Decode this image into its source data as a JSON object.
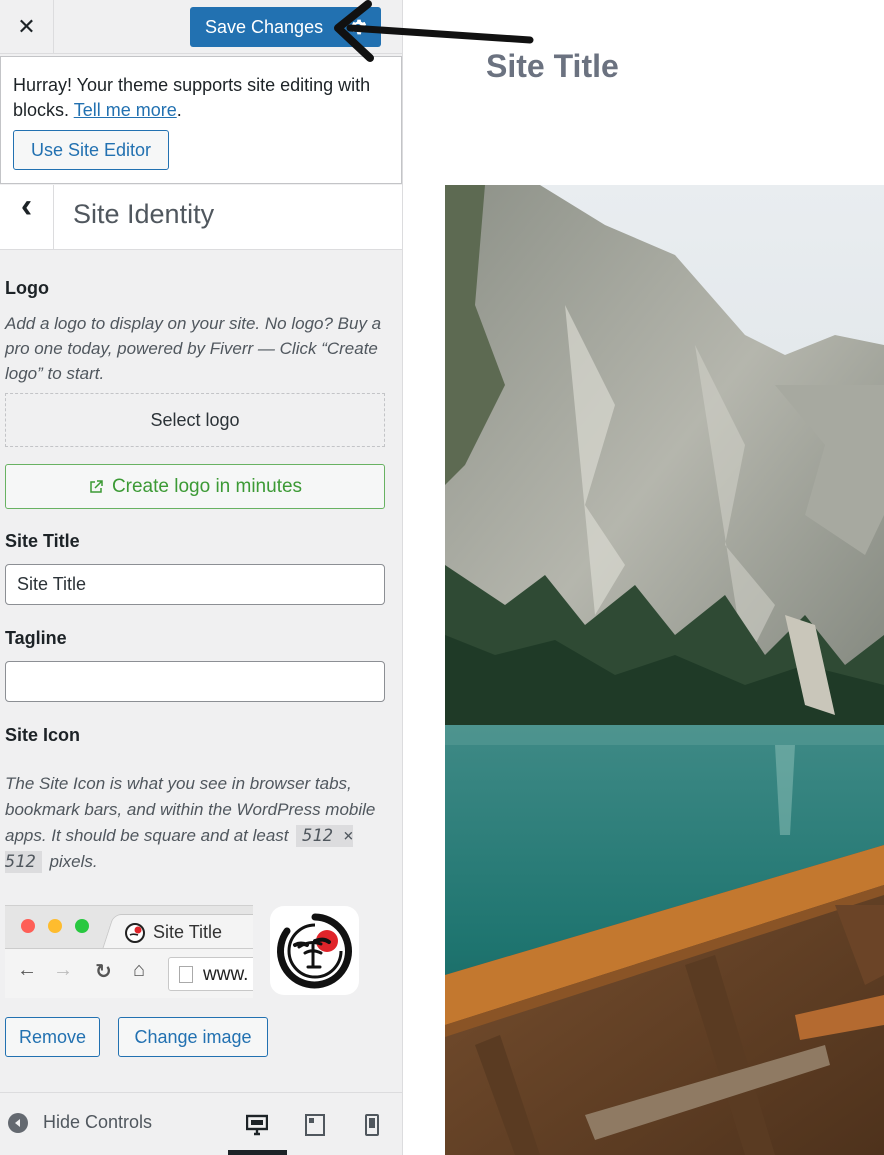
{
  "topbar": {
    "close_glyph": "✕",
    "save_label": "Save Changes"
  },
  "notice": {
    "text_before": "Hurray! Your theme supports site editing with blocks. ",
    "link_text": "Tell me more",
    "text_after": ".",
    "button_label": "Use Site Editor"
  },
  "section": {
    "back_glyph": "‹",
    "title": "Site Identity"
  },
  "logo": {
    "label": "Logo",
    "description": "Add a logo to display on your site. No logo? Buy a pro one today, powered by Fiverr — Click “Create logo” to start.",
    "select_label": "Select logo",
    "create_label": "Create logo in minutes"
  },
  "site_title": {
    "label": "Site Title",
    "value": "Site Title"
  },
  "tagline": {
    "label": "Tagline",
    "value": ""
  },
  "site_icon": {
    "label": "Site Icon",
    "desc_before": "The Site Icon is what you see in browser tabs, bookmark bars, and within the WordPress mobile apps. It should be square and at least ",
    "dimension": "512 × 512",
    "desc_after": " pixels.",
    "browser_tab_title": "Site Title",
    "browser_url": "www.",
    "remove_label": "Remove",
    "change_label": "Change image"
  },
  "footer": {
    "hide_controls_label": "Hide Controls",
    "devices": [
      "desktop",
      "tablet",
      "mobile"
    ],
    "active_device": "desktop"
  },
  "preview": {
    "site_title": "Site Title"
  },
  "colors": {
    "primary": "#2271b1",
    "create_logo_green": "#3c9a35",
    "sidebar_bg": "#f0f0f1"
  }
}
